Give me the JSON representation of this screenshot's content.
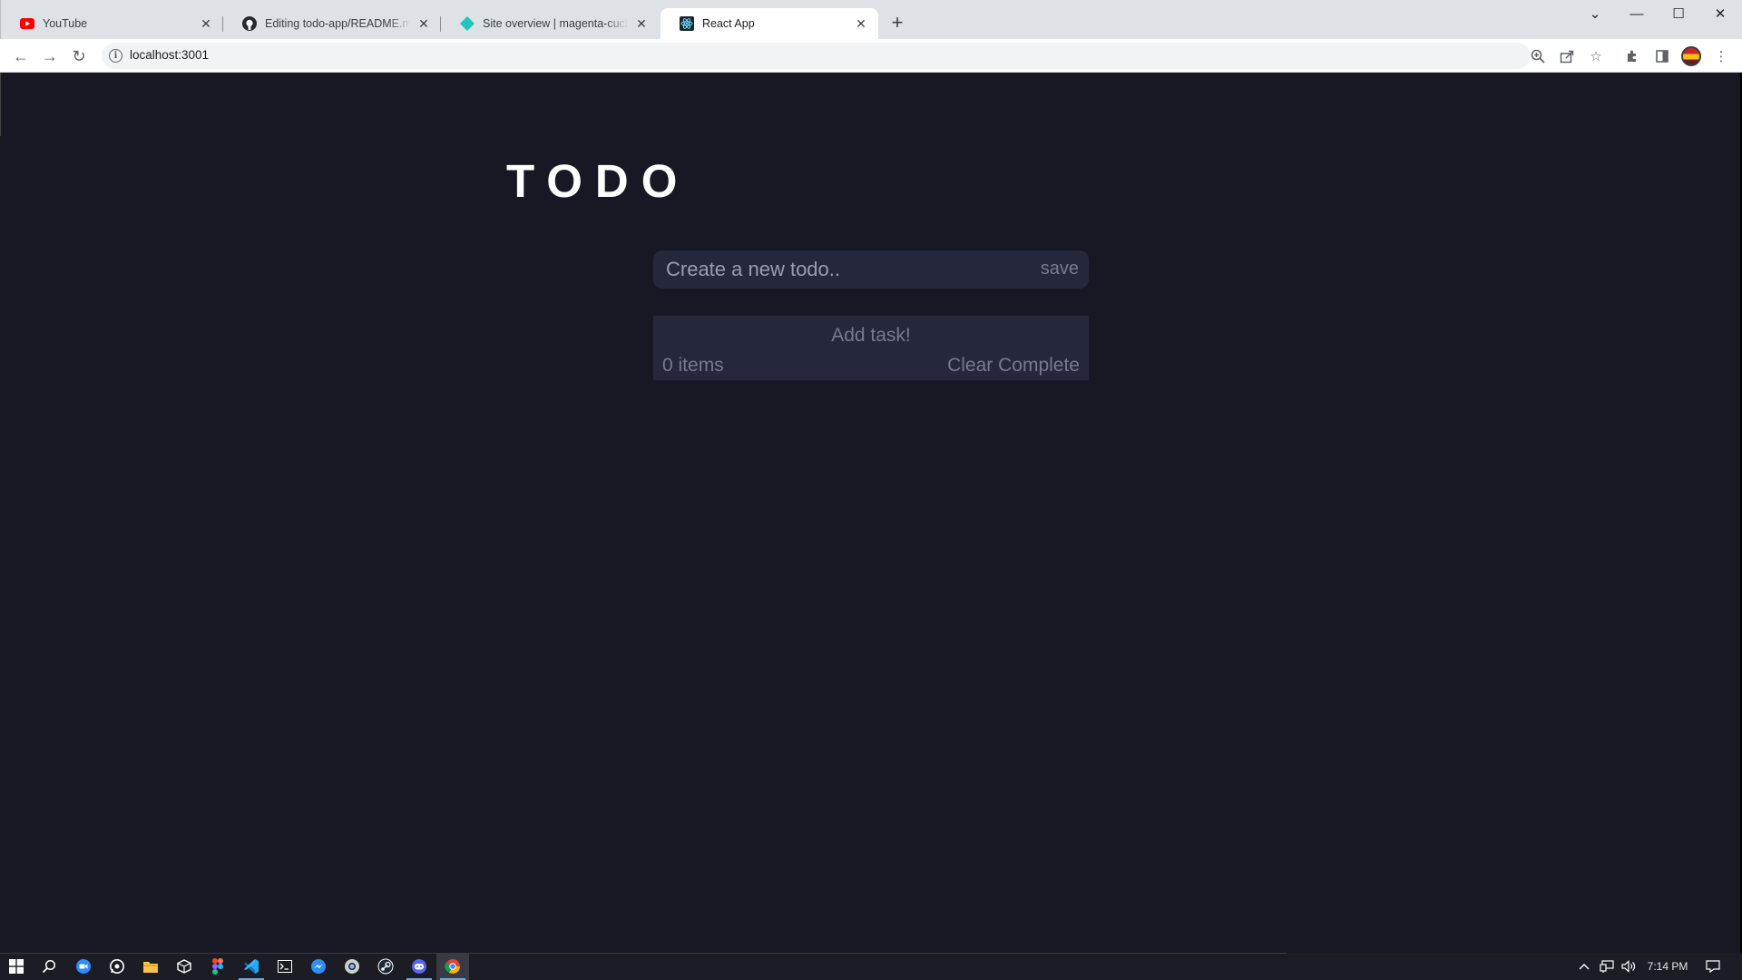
{
  "browser": {
    "tabs": [
      {
        "title": "YouTube",
        "icon": "youtube-icon",
        "active": false
      },
      {
        "title": "Editing todo-app/README.md at",
        "icon": "github-icon",
        "active": false
      },
      {
        "title": "Site overview | magenta-cuchufli",
        "icon": "netlify-icon",
        "active": false
      },
      {
        "title": "React App",
        "icon": "react-icon",
        "active": true
      }
    ],
    "url": "localhost:3001"
  },
  "app": {
    "title": "TODO",
    "input_placeholder": "Create a new todo..",
    "save_label": "save",
    "empty_message": "Add task!",
    "items_count": "0 items",
    "clear_label": "Clear Complete",
    "colors": {
      "background": "#181824",
      "panel": "#25273c",
      "muted_text": "#777a92",
      "title_text": "#ffffff"
    }
  },
  "taskbar": {
    "time": "7:14 PM"
  }
}
